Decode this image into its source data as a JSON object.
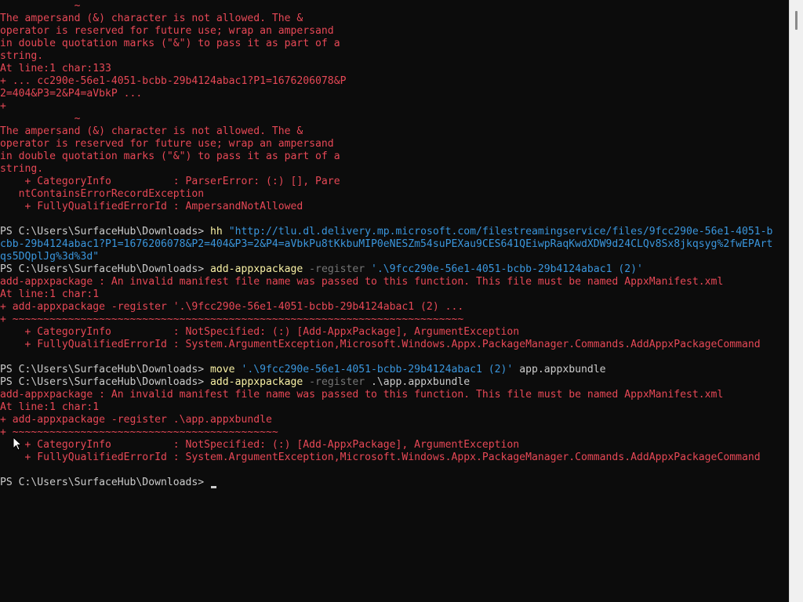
{
  "terminal": {
    "lines": [
      {
        "segs": [
          {
            "t": "            ~",
            "c": "err"
          }
        ]
      },
      {
        "segs": [
          {
            "t": "The ampersand (&) character is not allowed. The &",
            "c": "err"
          }
        ]
      },
      {
        "segs": [
          {
            "t": "operator is reserved for future use; wrap an ampersand",
            "c": "err"
          }
        ]
      },
      {
        "segs": [
          {
            "t": "in double quotation marks (\"&\") to pass it as part of a",
            "c": "err"
          }
        ]
      },
      {
        "segs": [
          {
            "t": "string.",
            "c": "err"
          }
        ]
      },
      {
        "segs": [
          {
            "t": "At line:1 char:133",
            "c": "err"
          }
        ]
      },
      {
        "segs": [
          {
            "t": "+ ... cc290e-56e1-4051-bcbb-29b4124abac1?P1=1676206078&P",
            "c": "err"
          }
        ]
      },
      {
        "segs": [
          {
            "t": "2=404&P3=2&P4=aVbkP ...",
            "c": "err"
          }
        ]
      },
      {
        "segs": [
          {
            "t": "+",
            "c": "err"
          }
        ]
      },
      {
        "segs": [
          {
            "t": "            ~",
            "c": "err"
          }
        ]
      },
      {
        "segs": [
          {
            "t": "The ampersand (&) character is not allowed. The &",
            "c": "err"
          }
        ]
      },
      {
        "segs": [
          {
            "t": "operator is reserved for future use; wrap an ampersand",
            "c": "err"
          }
        ]
      },
      {
        "segs": [
          {
            "t": "in double quotation marks (\"&\") to pass it as part of a",
            "c": "err"
          }
        ]
      },
      {
        "segs": [
          {
            "t": "string.",
            "c": "err"
          }
        ]
      },
      {
        "segs": [
          {
            "t": "    + CategoryInfo          : ParserError: (:) [], Pare",
            "c": "err"
          }
        ]
      },
      {
        "segs": [
          {
            "t": "   ntContainsErrorRecordException",
            "c": "err"
          }
        ]
      },
      {
        "segs": [
          {
            "t": "    + FullyQualifiedErrorId : AmpersandNotAllowed",
            "c": "err"
          }
        ]
      },
      {
        "segs": [
          {
            "t": "",
            "c": "plain"
          }
        ]
      },
      {
        "segs": [
          {
            "t": "PS C:\\Users\\SurfaceHub\\Downloads> ",
            "c": "prompt"
          },
          {
            "t": "hh ",
            "c": "cmd"
          },
          {
            "t": "\"http://tlu.dl.delivery.mp.microsoft.com/filestreamingservice/files/9fcc290e-56e1-4051-b",
            "c": "str"
          }
        ]
      },
      {
        "segs": [
          {
            "t": "cbb-29b4124abac1?P1=1676206078&P2=404&P3=2&P4=aVbkPu8tKkbuMIP0eNESZm54suPEXau9CES641QEiwpRaqKwdXDW9d24CLQv8Sx8jkqsyg%2fwEPArt",
            "c": "str"
          }
        ]
      },
      {
        "segs": [
          {
            "t": "qs5DQplJg%3d%3d\"",
            "c": "str"
          }
        ]
      },
      {
        "segs": [
          {
            "t": "PS C:\\Users\\SurfaceHub\\Downloads> ",
            "c": "prompt"
          },
          {
            "t": "add-appxpackage ",
            "c": "cmd"
          },
          {
            "t": "-register ",
            "c": "param"
          },
          {
            "t": "'.\\9fcc290e-56e1-4051-bcbb-29b4124abac1 (2)'",
            "c": "str"
          }
        ]
      },
      {
        "segs": [
          {
            "t": "add-appxpackage : An invalid manifest file name was passed to this function. This file must be named AppxManifest.xml",
            "c": "err"
          }
        ]
      },
      {
        "segs": [
          {
            "t": "At line:1 char:1",
            "c": "err"
          }
        ]
      },
      {
        "segs": [
          {
            "t": "+ add-appxpackage -register '.\\9fcc290e-56e1-4051-bcbb-29b4124abac1 (2) ...",
            "c": "err"
          }
        ]
      },
      {
        "segs": [
          {
            "t": "+ ~~~~~~~~~~~~~~~~~~~~~~~~~~~~~~~~~~~~~~~~~~~~~~~~~~~~~~~~~~~~~~~~~~~~~~~~~",
            "c": "err"
          }
        ]
      },
      {
        "segs": [
          {
            "t": "    + CategoryInfo          : NotSpecified: (:) [Add-AppxPackage], ArgumentException",
            "c": "err"
          }
        ]
      },
      {
        "segs": [
          {
            "t": "    + FullyQualifiedErrorId : System.ArgumentException,Microsoft.Windows.Appx.PackageManager.Commands.AddAppxPackageCommand",
            "c": "err"
          }
        ]
      },
      {
        "segs": [
          {
            "t": "",
            "c": "plain"
          }
        ]
      },
      {
        "segs": [
          {
            "t": "PS C:\\Users\\SurfaceHub\\Downloads> ",
            "c": "prompt"
          },
          {
            "t": "move ",
            "c": "cmd"
          },
          {
            "t": "'.\\9fcc290e-56e1-4051-bcbb-29b4124abac1 (2)'",
            "c": "str"
          },
          {
            "t": " app.appxbundle",
            "c": "plain"
          }
        ]
      },
      {
        "segs": [
          {
            "t": "PS C:\\Users\\SurfaceHub\\Downloads> ",
            "c": "prompt"
          },
          {
            "t": "add-appxpackage ",
            "c": "cmd"
          },
          {
            "t": "-register ",
            "c": "param"
          },
          {
            "t": ".\\app.appxbundle",
            "c": "plain"
          }
        ]
      },
      {
        "segs": [
          {
            "t": "add-appxpackage : An invalid manifest file name was passed to this function. This file must be named AppxManifest.xml",
            "c": "err"
          }
        ]
      },
      {
        "segs": [
          {
            "t": "At line:1 char:1",
            "c": "err"
          }
        ]
      },
      {
        "segs": [
          {
            "t": "+ add-appxpackage -register .\\app.appxbundle",
            "c": "err"
          }
        ]
      },
      {
        "segs": [
          {
            "t": "+ ~~~~~~~~~~~~~~~~~~~~~~~~~~~~~~~~~~~~~~~~~~~",
            "c": "err"
          }
        ]
      },
      {
        "segs": [
          {
            "t": "    + CategoryInfo          : NotSpecified: (:) [Add-AppxPackage], ArgumentException",
            "c": "err"
          }
        ]
      },
      {
        "segs": [
          {
            "t": "    + FullyQualifiedErrorId : System.ArgumentException,Microsoft.Windows.Appx.PackageManager.Commands.AddAppxPackageCommand",
            "c": "err"
          }
        ]
      },
      {
        "segs": [
          {
            "t": "",
            "c": "plain"
          }
        ]
      },
      {
        "segs": [
          {
            "t": "PS C:\\Users\\SurfaceHub\\Downloads> ",
            "c": "prompt"
          }
        ],
        "cursor": true
      }
    ]
  },
  "colors": {
    "background": "#0c0c0c",
    "foreground": "#cccccc",
    "error": "#e74856",
    "command": "#f9f1a5",
    "parameter": "#767676",
    "string": "#3a96dd"
  },
  "icons": {
    "pointer": "mouse-pointer-icon",
    "scrollbar": "vertical-scrollbar"
  }
}
